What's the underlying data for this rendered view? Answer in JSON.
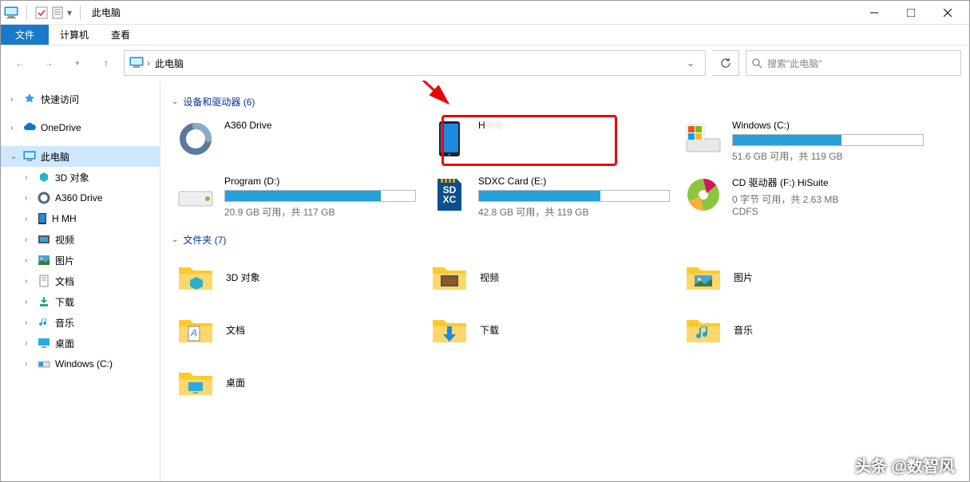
{
  "title": "此电脑",
  "ribbon": {
    "file": "文件",
    "computer": "计算机",
    "view": "查看"
  },
  "address": {
    "crumb": "此电脑"
  },
  "search": {
    "placeholder": "搜索\"此电脑\""
  },
  "sidebar": {
    "quick": "快速访问",
    "onedrive": "OneDrive",
    "thispc": "此电脑",
    "objs3d": "3D 对象",
    "a360": "A360 Drive",
    "device": "H        MH",
    "videos": "视频",
    "pictures": "图片",
    "documents": "文档",
    "downloads": "下载",
    "music": "音乐",
    "desktop": "桌面",
    "windows_c": "Windows (C:)"
  },
  "groups": {
    "devices": "设备和驱动器 (6)",
    "folders": "文件夹 (7)"
  },
  "drives": {
    "a360": {
      "name": "A360 Drive"
    },
    "phone": {
      "name": "H            H"
    },
    "win_c": {
      "name": "Windows (C:)",
      "sub": "51.6 GB 可用，共 119 GB",
      "fill": 57
    },
    "prog_d": {
      "name": "Program (D:)",
      "sub": "20.9 GB 可用，共 117 GB",
      "fill": 82
    },
    "sdxc_e": {
      "name": "SDXC Card (E:)",
      "sub": "42.8 GB 可用，共 119 GB",
      "fill": 64
    },
    "cd_f": {
      "name": "CD 驱动器 (F:) HiSuite",
      "sub": "0 字节 可用，共 2.63 MB",
      "sub2": "CDFS"
    }
  },
  "folders": {
    "objs3d": "3D 对象",
    "videos": "视频",
    "pictures": "图片",
    "documents": "文档",
    "downloads": "下载",
    "music": "音乐",
    "desktop": "桌面"
  },
  "watermark": "头条 @数智风"
}
